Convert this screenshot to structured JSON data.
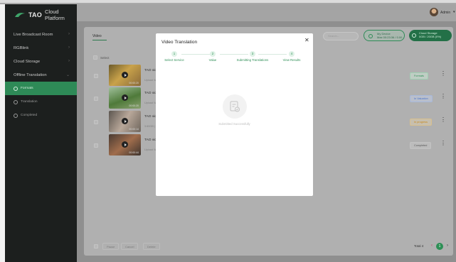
{
  "brand": {
    "logo_text": "TAO",
    "platform": "Cloud Platform"
  },
  "sidebar": {
    "items": [
      {
        "label": "Live Broadcast Room"
      },
      {
        "label": "RGBlink"
      },
      {
        "label": "Cloud Storage"
      },
      {
        "label": "Offline Translation"
      }
    ],
    "subitems": [
      {
        "label": "Formats",
        "active": true
      },
      {
        "label": "Translation",
        "active": false
      },
      {
        "label": "Completed",
        "active": false
      }
    ]
  },
  "header": {
    "user": "Admin"
  },
  "toolbar": {
    "tab": "Video",
    "search_placeholder": "Search...",
    "device_label": "My Device",
    "device_sub": "Max 00:23:36 / 0.00",
    "cloud_label": "Cloud Storage",
    "cloud_sub": "0GB / 20GB (0%)"
  },
  "list": {
    "select_label": "Select",
    "rows": [
      {
        "title": "TAO video.r",
        "sub": "Upload Wor",
        "duration": "00:00:20",
        "status": "Formats",
        "status_color": "#2f8f57"
      },
      {
        "title": "TAO video.r",
        "sub": "Upload Wor",
        "duration": "00:00:20",
        "status": "In Valuation",
        "status_color": "#4a74c9"
      },
      {
        "title": "TAO video.r",
        "sub": "3.60GB | ...",
        "duration": "00:00:14",
        "status": "In progress",
        "status_color": "#c88a1c"
      },
      {
        "title": "TAO video.r",
        "sub": "Upload Wor",
        "duration": "00:00:44",
        "status": "Completed",
        "status_color": "#6b6b6b"
      }
    ]
  },
  "footer": {
    "btn_pause": "Pause",
    "btn_cancel": "Cancel",
    "btn_delete": "Delete",
    "total": "Total 4",
    "page": "1"
  },
  "modal": {
    "title": "Video Translation",
    "steps": [
      {
        "num": "1",
        "label": "Select Service"
      },
      {
        "num": "2",
        "label": "Value"
      },
      {
        "num": "3",
        "label": "Submitting Translations"
      },
      {
        "num": "4",
        "label": "View Results"
      }
    ],
    "success_text": "Submitted Successfully",
    "accent": "#2f8f57"
  }
}
